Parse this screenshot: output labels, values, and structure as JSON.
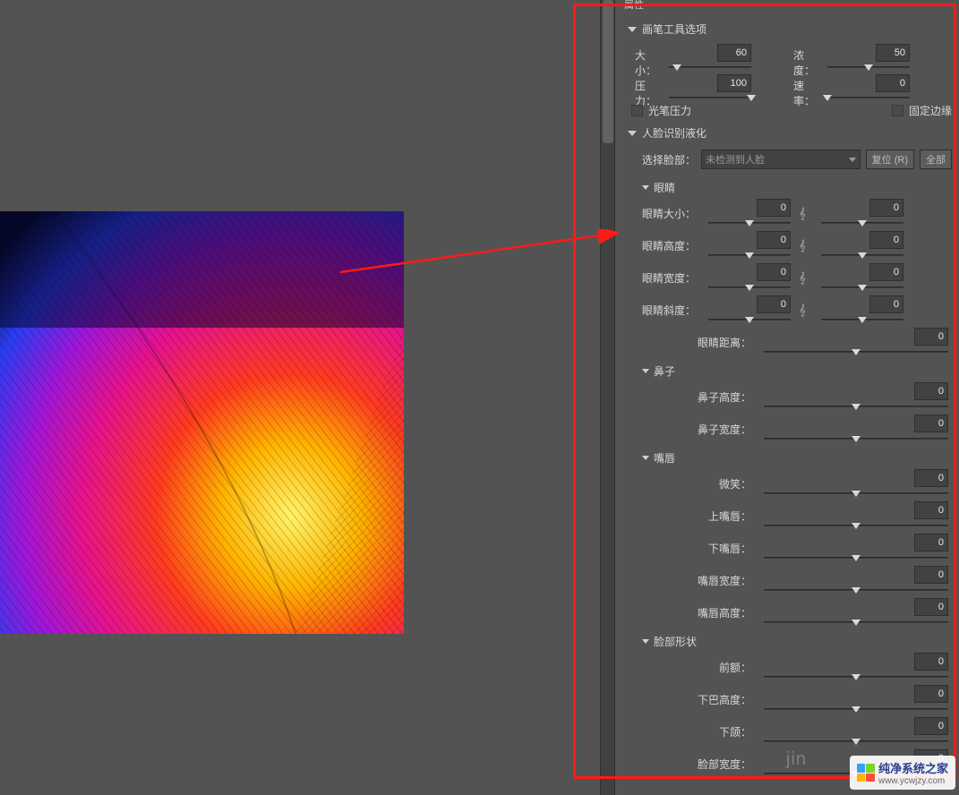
{
  "panel_tab": "属性",
  "sections": {
    "brush": {
      "title": "画笔工具选项",
      "size_label": "大小：",
      "size_value": "60",
      "density_label": "浓度：",
      "density_value": "50",
      "pressure_label": "压力：",
      "pressure_value": "100",
      "rate_label": "速率：",
      "rate_value": "0",
      "stylus_pressure": "光笔压力",
      "pin_edges": "固定边缘"
    },
    "face": {
      "title": "人脸识别液化",
      "select_face_label": "选择脸部：",
      "select_face_value": "未检测到人脸",
      "reset_btn": "复位 (R)",
      "all_btn": "全部"
    },
    "eyes": {
      "title": "眼睛",
      "size": "眼睛大小：",
      "height": "眼睛高度：",
      "width": "眼睛宽度：",
      "tilt": "眼睛斜度：",
      "distance": "眼睛距离：",
      "val": "0"
    },
    "nose": {
      "title": "鼻子",
      "height": "鼻子高度：",
      "width": "鼻子宽度：",
      "val": "0"
    },
    "mouth": {
      "title": "嘴唇",
      "smile": "微笑：",
      "upper": "上嘴唇：",
      "lower": "下嘴唇：",
      "width": "嘴唇宽度：",
      "height": "嘴唇高度：",
      "val": "0"
    },
    "shape": {
      "title": "脸部形状",
      "forehead": "前额：",
      "chin_height": "下巴高度：",
      "jaw": "下颌：",
      "face_width": "脸部宽度：",
      "val": "0"
    }
  },
  "watermark": {
    "title": "纯净系统之家",
    "url": "www.ycwjzy.com"
  },
  "ghost": "jin"
}
